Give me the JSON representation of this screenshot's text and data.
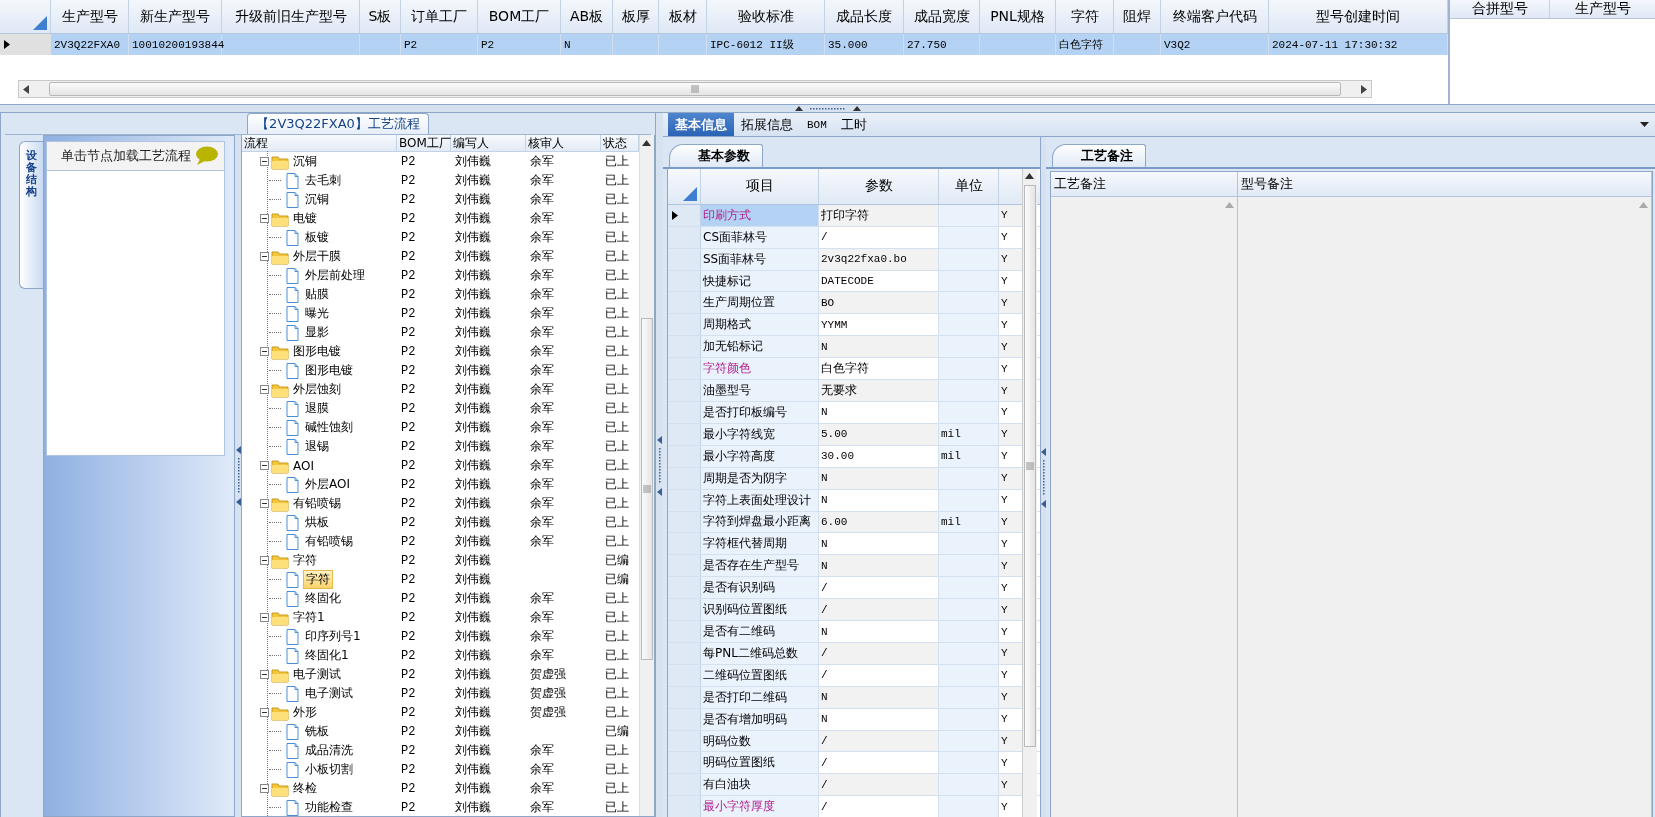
{
  "top_grid": {
    "columns": [
      "生产型号",
      "新生产型号",
      "升级前旧生产型号",
      "S板",
      "订单工厂",
      "BOM工厂",
      "AB板",
      "板厚",
      "板材",
      "验收标准",
      "成品长度",
      "成品宽度",
      "PNL规格",
      "字符",
      "阻焊",
      "终端客户代码",
      "型号创建时间"
    ],
    "rows": [
      {
        "selected": true,
        "cells": [
          "2V3Q22FXA0",
          "10010200193844",
          null,
          null,
          "P2",
          "P2",
          "N",
          null,
          null,
          "IPC-6012 II级",
          "35.000",
          "27.750",
          null,
          "白色字符",
          null,
          "V3Q2",
          "2024-07-11 17:30:32"
        ]
      }
    ]
  },
  "merge_grid": {
    "columns": [
      "合拼型号",
      "生产型号"
    ]
  },
  "flow_panel": {
    "title": "【2V3Q22FXA0】工艺流程",
    "side_tab": "设备结构",
    "hint": "单击节点加载工艺流程",
    "columns": [
      "流程",
      "BOM工厂",
      "编写人",
      "核审人",
      "状态"
    ],
    "tree": [
      {
        "name": "沉铜",
        "bom": "P2",
        "writer": "刘伟巍",
        "reviewer": "余军",
        "status": "已上",
        "selected": false,
        "expanded": true,
        "children": [
          {
            "name": "去毛刺",
            "bom": "P2",
            "writer": "刘伟巍",
            "reviewer": "余军",
            "status": "已上",
            "selected": false
          },
          {
            "name": "沉铜",
            "bom": "P2",
            "writer": "刘伟巍",
            "reviewer": "余军",
            "status": "已上",
            "selected": false
          }
        ]
      },
      {
        "name": "电镀",
        "bom": "P2",
        "writer": "刘伟巍",
        "reviewer": "余军",
        "status": "已上",
        "selected": false,
        "expanded": true,
        "children": [
          {
            "name": "板镀",
            "bom": "P2",
            "writer": "刘伟巍",
            "reviewer": "余军",
            "status": "已上",
            "selected": false
          }
        ]
      },
      {
        "name": "外层干膜",
        "bom": "P2",
        "writer": "刘伟巍",
        "reviewer": "余军",
        "status": "已上",
        "selected": false,
        "expanded": true,
        "children": [
          {
            "name": "外层前处理",
            "bom": "P2",
            "writer": "刘伟巍",
            "reviewer": "余军",
            "status": "已上",
            "selected": false
          },
          {
            "name": "贴膜",
            "bom": "P2",
            "writer": "刘伟巍",
            "reviewer": "余军",
            "status": "已上",
            "selected": false
          },
          {
            "name": "曝光",
            "bom": "P2",
            "writer": "刘伟巍",
            "reviewer": "余军",
            "status": "已上",
            "selected": false
          },
          {
            "name": "显影",
            "bom": "P2",
            "writer": "刘伟巍",
            "reviewer": "余军",
            "status": "已上",
            "selected": false
          }
        ]
      },
      {
        "name": "图形电镀",
        "bom": "P2",
        "writer": "刘伟巍",
        "reviewer": "余军",
        "status": "已上",
        "selected": false,
        "expanded": true,
        "children": [
          {
            "name": "图形电镀",
            "bom": "P2",
            "writer": "刘伟巍",
            "reviewer": "余军",
            "status": "已上",
            "selected": false
          }
        ]
      },
      {
        "name": "外层蚀刻",
        "bom": "P2",
        "writer": "刘伟巍",
        "reviewer": "余军",
        "status": "已上",
        "selected": false,
        "expanded": true,
        "children": [
          {
            "name": "退膜",
            "bom": "P2",
            "writer": "刘伟巍",
            "reviewer": "余军",
            "status": "已上",
            "selected": false
          },
          {
            "name": "碱性蚀刻",
            "bom": "P2",
            "writer": "刘伟巍",
            "reviewer": "余军",
            "status": "已上",
            "selected": false
          },
          {
            "name": "退锡",
            "bom": "P2",
            "writer": "刘伟巍",
            "reviewer": "余军",
            "status": "已上",
            "selected": false
          }
        ]
      },
      {
        "name": "AOI",
        "bom": "P2",
        "writer": "刘伟巍",
        "reviewer": "余军",
        "status": "已上",
        "selected": false,
        "expanded": true,
        "children": [
          {
            "name": "外层AOI",
            "bom": "P2",
            "writer": "刘伟巍",
            "reviewer": "余军",
            "status": "已上",
            "selected": false
          }
        ]
      },
      {
        "name": "有铅喷锡",
        "bom": "P2",
        "writer": "刘伟巍",
        "reviewer": "余军",
        "status": "已上",
        "selected": false,
        "expanded": true,
        "children": [
          {
            "name": "烘板",
            "bom": "P2",
            "writer": "刘伟巍",
            "reviewer": "余军",
            "status": "已上",
            "selected": false
          },
          {
            "name": "有铅喷锡",
            "bom": "P2",
            "writer": "刘伟巍",
            "reviewer": "余军",
            "status": "已上",
            "selected": false
          }
        ]
      },
      {
        "name": "字符",
        "bom": "P2",
        "writer": "刘伟巍",
        "status": "已编",
        "selected": false,
        "expanded": true,
        "children": [
          {
            "name": "字符",
            "bom": "P2",
            "writer": "刘伟巍",
            "status": "已编",
            "selected": true
          },
          {
            "name": "终固化",
            "bom": "P2",
            "writer": "刘伟巍",
            "reviewer": "余军",
            "status": "已上",
            "selected": false
          }
        ]
      },
      {
        "name": "字符1",
        "bom": "P2",
        "writer": "刘伟巍",
        "reviewer": "余军",
        "status": "已上",
        "selected": false,
        "expanded": true,
        "children": [
          {
            "name": "印序列号1",
            "bom": "P2",
            "writer": "刘伟巍",
            "reviewer": "余军",
            "status": "已上",
            "selected": false
          },
          {
            "name": "终固化1",
            "bom": "P2",
            "writer": "刘伟巍",
            "reviewer": "余军",
            "status": "已上",
            "selected": false
          }
        ]
      },
      {
        "name": "电子测试",
        "bom": "P2",
        "writer": "刘伟巍",
        "reviewer": "贺虚强",
        "status": "已上",
        "selected": false,
        "expanded": true,
        "children": [
          {
            "name": "电子测试",
            "bom": "P2",
            "writer": "刘伟巍",
            "reviewer": "贺虚强",
            "status": "已上",
            "selected": false
          }
        ]
      },
      {
        "name": "外形",
        "bom": "P2",
        "writer": "刘伟巍",
        "reviewer": "贺虚强",
        "status": "已上",
        "selected": false,
        "expanded": true,
        "children": [
          {
            "name": "铣板",
            "bom": "P2",
            "writer": "刘伟巍",
            "status": "已编",
            "selected": false
          },
          {
            "name": "成品清洗",
            "bom": "P2",
            "writer": "刘伟巍",
            "reviewer": "余军",
            "status": "已上",
            "selected": false
          },
          {
            "name": "小板切割",
            "bom": "P2",
            "writer": "刘伟巍",
            "reviewer": "余军",
            "status": "已上",
            "selected": false
          }
        ]
      },
      {
        "name": "终检",
        "bom": "P2",
        "writer": "刘伟巍",
        "reviewer": "余军",
        "status": "已上",
        "selected": false,
        "expanded": true,
        "children": [
          {
            "name": "功能检查",
            "bom": "P2",
            "writer": "刘伟巍",
            "reviewer": "余军",
            "status": "已上",
            "selected": false
          }
        ]
      }
    ]
  },
  "tabs": [
    {
      "label": "基本信息",
      "selected": true
    },
    {
      "label": "拓展信息",
      "selected": false
    },
    {
      "label": "BOM",
      "selected": false
    },
    {
      "label": "工时",
      "selected": false
    }
  ],
  "params_panel": {
    "subtab": "基本参数",
    "columns": [
      "项目",
      "参数",
      "单位"
    ],
    "rows": [
      {
        "item": "印刷方式",
        "value": "打印字符",
        "flag": "Y",
        "required": true,
        "selected": true
      },
      {
        "item": "CS面菲林号",
        "value": "/",
        "flag": "Y",
        "required": false,
        "selected": false
      },
      {
        "item": "SS面菲林号",
        "value": "2v3q22fxa0.bo",
        "flag": "Y",
        "required": false,
        "selected": false
      },
      {
        "item": "快捷标记",
        "value": "DATECODE",
        "flag": "Y",
        "required": false,
        "selected": false
      },
      {
        "item": "生产周期位置",
        "value": "BO",
        "flag": "Y",
        "required": false,
        "selected": false
      },
      {
        "item": "周期格式",
        "value": "YYMM",
        "flag": "Y",
        "required": false,
        "selected": false
      },
      {
        "item": "加无铅标记",
        "value": "N",
        "flag": "Y",
        "required": false,
        "selected": false
      },
      {
        "item": "字符颜色",
        "value": "白色字符",
        "flag": "Y",
        "required": true,
        "selected": false
      },
      {
        "item": "油墨型号",
        "value": "无要求",
        "flag": "Y",
        "required": false,
        "selected": false
      },
      {
        "item": "是否打印板编号",
        "value": "N",
        "flag": "Y",
        "required": false,
        "selected": false
      },
      {
        "item": "最小字符线宽",
        "value": "5.00",
        "unit": "mil",
        "flag": "Y",
        "required": false,
        "selected": false
      },
      {
        "item": "最小字符高度",
        "value": "30.00",
        "unit": "mil",
        "flag": "Y",
        "required": false,
        "selected": false
      },
      {
        "item": "周期是否为阴字",
        "value": "N",
        "flag": "Y",
        "required": false,
        "selected": false
      },
      {
        "item": "字符上表面处理设计",
        "value": "N",
        "flag": "Y",
        "required": false,
        "selected": false
      },
      {
        "item": "字符到焊盘最小距离",
        "value": "6.00",
        "unit": "mil",
        "flag": "Y",
        "required": false,
        "selected": false
      },
      {
        "item": "字符框代替周期",
        "value": "N",
        "flag": "Y",
        "required": false,
        "selected": false
      },
      {
        "item": "是否存在生产型号",
        "value": "N",
        "flag": "Y",
        "required": false,
        "selected": false
      },
      {
        "item": "是否有识别码",
        "value": "/",
        "flag": "Y",
        "required": false,
        "selected": false
      },
      {
        "item": "识别码位置图纸",
        "value": "/",
        "flag": "Y",
        "required": false,
        "selected": false
      },
      {
        "item": "是否有二维码",
        "value": "N",
        "flag": "Y",
        "required": false,
        "selected": false
      },
      {
        "item": "每PNL二维码总数",
        "value": "/",
        "flag": "Y",
        "required": false,
        "selected": false
      },
      {
        "item": "二维码位置图纸",
        "value": "/",
        "flag": "Y",
        "required": false,
        "selected": false
      },
      {
        "item": "是否打印二维码",
        "value": "N",
        "flag": "Y",
        "required": false,
        "selected": false
      },
      {
        "item": "是否有增加明码",
        "value": "N",
        "flag": "Y",
        "required": false,
        "selected": false
      },
      {
        "item": "明码位数",
        "value": "/",
        "flag": "Y",
        "required": false,
        "selected": false
      },
      {
        "item": "明码位置图纸",
        "value": "/",
        "flag": "Y",
        "required": false,
        "selected": false
      },
      {
        "item": "有白油块",
        "value": "/",
        "flag": "Y",
        "required": false,
        "selected": false
      },
      {
        "item": "最小字符厚度",
        "value": "/",
        "flag": "Y",
        "required": true,
        "selected": false
      }
    ]
  },
  "notes_panel": {
    "subtab": "工艺备注",
    "columns": [
      "工艺备注",
      "型号备注"
    ]
  }
}
